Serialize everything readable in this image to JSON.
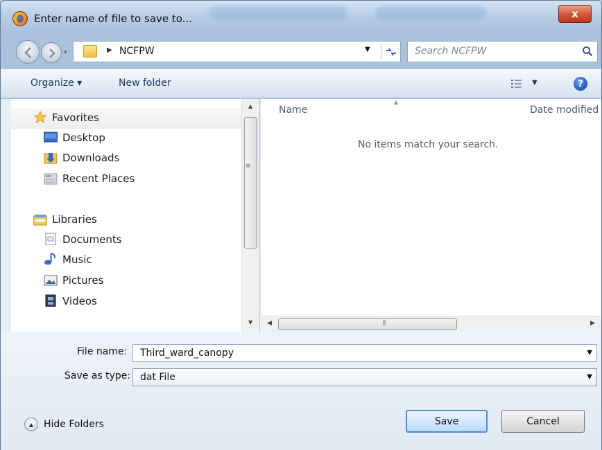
{
  "window": {
    "title": "Enter name of file to save to...",
    "close_label": "x"
  },
  "address": {
    "current_folder": "NCFPW",
    "search_placeholder": "Search NCFPW"
  },
  "toolbar": {
    "organize_label": "Organize ▾",
    "new_folder_label": "New folder"
  },
  "nav": {
    "favorites_label": "Favorites",
    "favorites": [
      "Desktop",
      "Downloads",
      "Recent Places"
    ],
    "libraries_label": "Libraries",
    "libraries": [
      "Documents",
      "Music",
      "Pictures",
      "Videos"
    ]
  },
  "content": {
    "columns": [
      "Name",
      "Date modified"
    ],
    "empty_message": "No items match your search."
  },
  "form": {
    "file_name_label": "File name:",
    "file_name_value": "Third_ward_canopy",
    "save_type_label": "Save as type:",
    "save_type_value": "dat File"
  },
  "footer": {
    "hide_folders_label": "Hide Folders",
    "save_label": "Save",
    "cancel_label": "Cancel"
  },
  "colors": {
    "accent": "#4a8fd8",
    "close": "#d45a3c"
  }
}
